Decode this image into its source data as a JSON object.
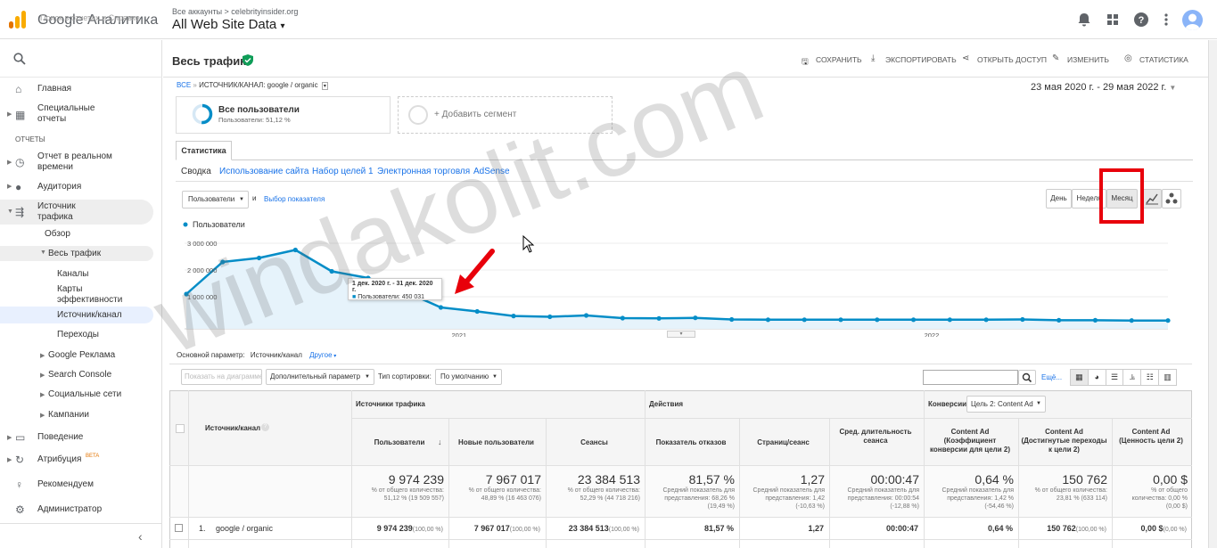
{
  "app": {
    "name": "Google Аналитика",
    "account_path": "Все аккаунты > celebrityinsider.org",
    "view": "All Web Site Data"
  },
  "search": {
    "placeholder": "Поиск в отчетах и Справке"
  },
  "sidebar": {
    "home": "Главная",
    "custom": "Специальные отчеты",
    "reports_header": "ОТЧЕТЫ",
    "realtime": "Отчет в реальном времени",
    "audience": "Аудитория",
    "acquisition": "Источник трафика",
    "overview": "Обзор",
    "all_traffic": "Весь трафик",
    "channels": "Каналы",
    "treemaps": "Карты эффективности",
    "source_medium": "Источник/канал",
    "referrals": "Переходы",
    "google_ads": "Google Реклама",
    "search_console": "Search Console",
    "social": "Социальные сети",
    "campaigns": "Кампании",
    "behavior": "Поведение",
    "attribution": "Атрибуция",
    "attribution_badge": "BETA",
    "discover": "Рекомендуем",
    "admin": "Администратор"
  },
  "page": {
    "title": "Весь трафик",
    "actions": [
      "СОХРАНИТЬ",
      "ЭКСПОРТИРОВАТЬ",
      "ОТКРЫТЬ ДОСТУП",
      "ИЗМЕНИТЬ",
      "СТАТИСТИКА"
    ],
    "breadcrumb_all": "ВСЕ",
    "breadcrumb_current": "ИСТОЧНИК/КАНАЛ: google / organic",
    "date_range": "23 мая 2020 г. - 29 мая 2022 г.",
    "segment_name": "Все пользователи",
    "segment_sub": "Пользователи: 51,12 %",
    "add_segment": "+ Добавить сегмент",
    "tab_stats": "Статистика",
    "subtabs": [
      "Сводка",
      "Использование сайта",
      "Набор целей 1",
      "Электронная торговля",
      "AdSense"
    ],
    "metric_select": "Пользователи",
    "and": "и",
    "choose_metric": "Выбор показателя",
    "period_buttons": [
      "День",
      "Неделя",
      "Месяц"
    ],
    "legend": "Пользователи",
    "tooltip_date": "1 дек. 2020 г. - 31 дек. 2020 г.",
    "tooltip_value": "Пользователи: 450 031",
    "primary_dim_label": "Основной параметр:",
    "primary_dim_value": "Источник/канал",
    "primary_dim_other": "Другое",
    "plot_rows": "Показать на диаграмме",
    "secondary_dim": "Дополнительный параметр",
    "sort_type_label": "Тип сортировки:",
    "sort_type": "По умолчанию",
    "more": "Ещё..."
  },
  "chart_data": {
    "type": "line",
    "series": [
      {
        "name": "Пользователи",
        "values": [
          1100000,
          2300000,
          2450000,
          2750000,
          1950000,
          1700000,
          1200000,
          600000,
          450031,
          280000,
          250000,
          300000,
          200000,
          190000,
          210000,
          150000,
          140000,
          140000,
          140000,
          140000,
          140000,
          140000,
          140000,
          150000,
          120000,
          120000,
          110000,
          110000
        ]
      }
    ],
    "x_ticks": [
      "2021",
      "2022"
    ],
    "y_ticks": [
      "3 000 000",
      "2 000 000",
      "1 000 000"
    ],
    "ylim": [
      0,
      3500000
    ],
    "color": "#058dc7"
  },
  "table": {
    "dim_header": "Источник/канал",
    "groups": [
      "Источники трафика",
      "Действия",
      "Конверсии"
    ],
    "conv_goal": "Цель 2: Content Ad",
    "columns": [
      {
        "h": "Пользователи",
        "total": "9 974 239",
        "sub": "% от общего количества: 51,12 % (19 509 557)",
        "row": "9 974 239",
        "rowp": "(100,00 %)"
      },
      {
        "h": "Новые пользователи",
        "total": "7 967 017",
        "sub": "% от общего количества: 48,89 % (16 463 076)",
        "row": "7 967 017",
        "rowp": "(100,00 %)"
      },
      {
        "h": "Сеансы",
        "total": "23 384 513",
        "sub": "% от общего количества: 52,29 % (44 718 216)",
        "row": "23 384 513",
        "rowp": "(100,00 %)"
      },
      {
        "h": "Показатель отказов",
        "total": "81,57 %",
        "sub": "Средний показатель для представления: 68,26 % (19,49 %)",
        "row": "81,57 %",
        "rowp": ""
      },
      {
        "h": "Страниц/сеанс",
        "total": "1,27",
        "sub": "Средний показатель для представления: 1,42 (-10,63 %)",
        "row": "1,27",
        "rowp": ""
      },
      {
        "h": "Сред. длительность сеанса",
        "total": "00:00:47",
        "sub": "Средний показатель для представления: 00:00:54 (-12,88 %)",
        "row": "00:00:47",
        "rowp": ""
      },
      {
        "h": "Content Ad (Коэффициент конверсии для цели 2)",
        "total": "0,64 %",
        "sub": "Средний показатель для представления: 1,42 % (-54,46 %)",
        "row": "0,64 %",
        "rowp": ""
      },
      {
        "h": "Content Ad (Достигнутые переходы к цели 2)",
        "total": "150 762",
        "sub": "% от общего количества: 23,81 % (633 114)",
        "row": "150 762",
        "rowp": "(100,00 %)"
      },
      {
        "h": "Content Ad (Ценность цели 2)",
        "total": "0,00 $",
        "sub": "% от общего количества: 0,00 % (0,00 $)",
        "row": "0,00 $",
        "rowp": "(0,00 %)"
      }
    ],
    "row1_index": "1.",
    "row1_name": "google / organic"
  }
}
